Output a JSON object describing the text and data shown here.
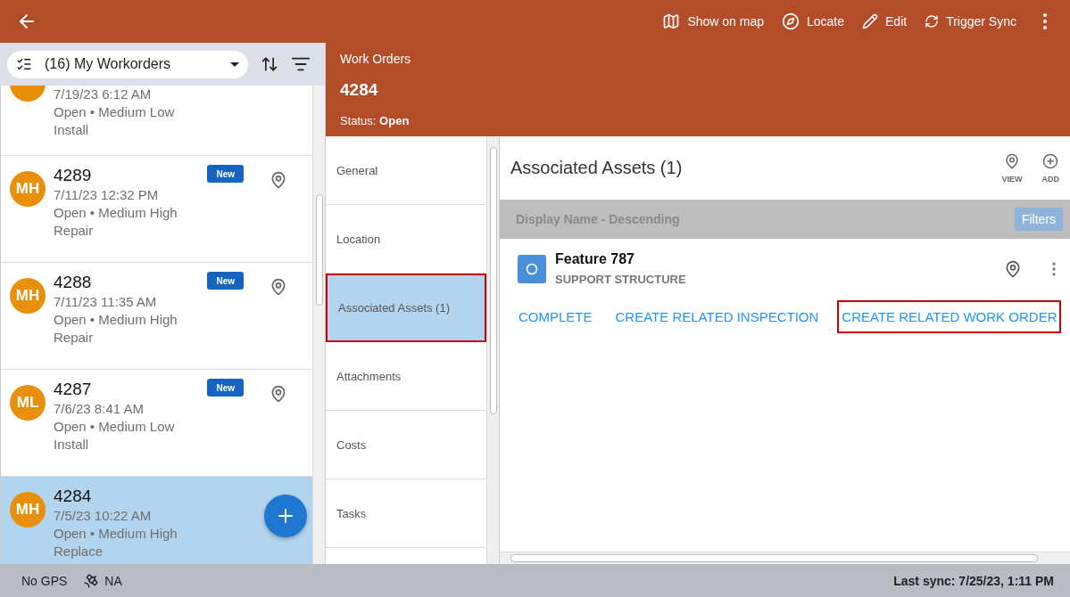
{
  "toolbar": {
    "actions": [
      {
        "kind": "map",
        "label": "Show on map"
      },
      {
        "kind": "locate",
        "label": "Locate"
      },
      {
        "kind": "edit",
        "label": "Edit"
      },
      {
        "kind": "sync",
        "label": "Trigger Sync"
      }
    ]
  },
  "list_filter": {
    "value": "(16) My Workorders"
  },
  "workorders": [
    {
      "kind": "partial",
      "date": "7/19/23 6:12 AM",
      "status": "Open • Medium Low",
      "type": "Install",
      "selected": false
    },
    {
      "kind": "full",
      "initials": "MH",
      "number": "4289",
      "date": "7/11/23 12:32 PM",
      "status": "Open • Medium High",
      "type": "Repair",
      "new_label": "New",
      "selected": false
    },
    {
      "kind": "full",
      "initials": "MH",
      "number": "4288",
      "date": "7/11/23 11:35 AM",
      "status": "Open • Medium High",
      "type": "Repair",
      "new_label": "New",
      "selected": false
    },
    {
      "kind": "full",
      "initials": "ML",
      "number": "4287",
      "date": "7/6/23 8:41 AM",
      "status": "Open • Medium Low",
      "type": "Install",
      "new_label": "New",
      "selected": false
    },
    {
      "kind": "full",
      "initials": "MH",
      "number": "4284",
      "date": "7/5/23 10:22 AM",
      "status": "Open • Medium High",
      "type": "Replace",
      "selected": true
    }
  ],
  "header": {
    "breadcrumb": "Work Orders",
    "title": "4284",
    "status_label": "Status:",
    "status_value": "Open"
  },
  "nav": [
    {
      "label": "General",
      "selected": false
    },
    {
      "label": "Location",
      "selected": false
    },
    {
      "label": "Associated Assets (1)",
      "selected": true
    },
    {
      "label": "Attachments",
      "selected": false
    },
    {
      "label": "Costs",
      "selected": false
    },
    {
      "label": "Tasks",
      "selected": false
    }
  ],
  "panel": {
    "title": "Associated Assets (1)",
    "tools": [
      {
        "kind": "view",
        "label": "VIEW"
      },
      {
        "kind": "add",
        "label": "ADD"
      }
    ],
    "sort": "Display Name - Descending",
    "filters": "Filters",
    "asset": {
      "name": "Feature 787",
      "type": "SUPPORT STRUCTURE"
    },
    "actions": [
      {
        "label": "COMPLETE",
        "highlighted": false
      },
      {
        "label": "CREATE RELATED INSPECTION",
        "highlighted": false
      },
      {
        "label": "CREATE RELATED WORK ORDER",
        "highlighted": true
      }
    ]
  },
  "status_bar": {
    "gps": "No GPS",
    "satellite": "NA",
    "last_sync": "Last sync: 7/25/23, 1:11 PM"
  }
}
